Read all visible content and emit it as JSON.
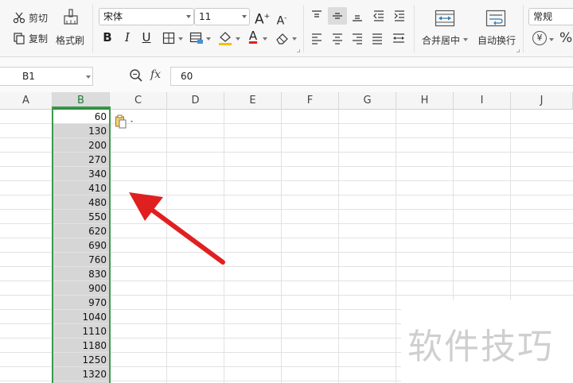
{
  "ribbon": {
    "cut_label": "剪切",
    "copy_label": "复制",
    "format_painter_label": "格式刷",
    "font_name": "宋体",
    "font_size": "11",
    "bold_glyph": "B",
    "italic_glyph": "I",
    "underline_glyph": "U",
    "increase_font_glyph": "A",
    "decrease_font_glyph": "A",
    "font_color_glyph": "A",
    "merge_center_label": "合并居中",
    "wrap_text_label": "自动换行",
    "number_format": "常规",
    "currency_glyph": "¥",
    "percent_glyph": "%"
  },
  "formula_bar": {
    "cell_ref": "B1",
    "fx_label": "fx",
    "value": "60"
  },
  "columns": [
    "A",
    "B",
    "C",
    "D",
    "E",
    "F",
    "G",
    "H",
    "I",
    "J"
  ],
  "selected_column": "B",
  "column_b_values": [
    "60",
    "130",
    "200",
    "270",
    "340",
    "410",
    "480",
    "550",
    "620",
    "690",
    "760",
    "830",
    "900",
    "970",
    "1040",
    "1110",
    "1180",
    "1250",
    "1320"
  ],
  "watermark": "软件技巧",
  "colors": {
    "selection_border": "#3c9a4a",
    "arrow": "#e02020",
    "selection_fill": "#d6d6d6"
  }
}
